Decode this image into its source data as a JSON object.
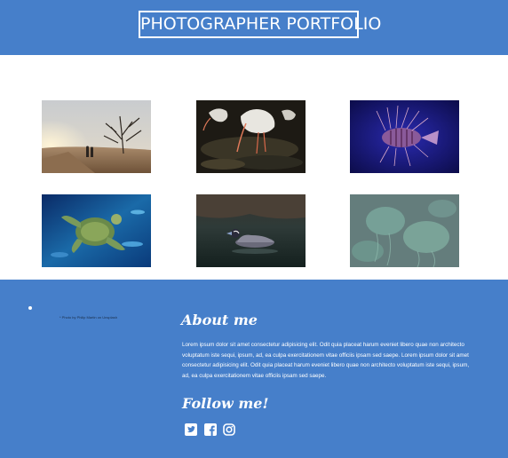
{
  "header": {
    "logo_text": "PHOTOGRAPHER PORTFOLIO"
  },
  "gallery": {
    "photos": [
      {
        "name": "couple walking toward sunset by bare tree"
      },
      {
        "name": "white ibises wading in dark water"
      },
      {
        "name": "lionfish on deep blue background"
      },
      {
        "name": "sea turtle swimming in aquarium"
      },
      {
        "name": "duck floating on dark pond"
      },
      {
        "name": "jellyfish in teal water"
      }
    ]
  },
  "footer": {
    "credit": "* Photo by Philip Martin on Unsplash",
    "about_title": "About me",
    "about_text": "Lorem ipsum dolor sit amet consectetur adipisicing elit. Odit quia placeat harum eveniet libero quae non architecto voluptatum iste sequi, ipsum, ad, ea culpa exercitationem vitae officiis ipsam sed saepe. Lorem ipsum dolor sit amet consectetur adipisicing elit. Odit quia placeat harum eveniet libero quae non architecto voluptatum iste sequi, ipsum, ad, ea culpa exercitationem vitae officiis ipsam sed saepe.",
    "follow_title": "Follow me!",
    "social": [
      {
        "icon": "twitter-icon"
      },
      {
        "icon": "facebook-icon"
      },
      {
        "icon": "instagram-icon"
      }
    ]
  },
  "colors": {
    "brand_blue": "#467fca",
    "white": "#ffffff"
  }
}
